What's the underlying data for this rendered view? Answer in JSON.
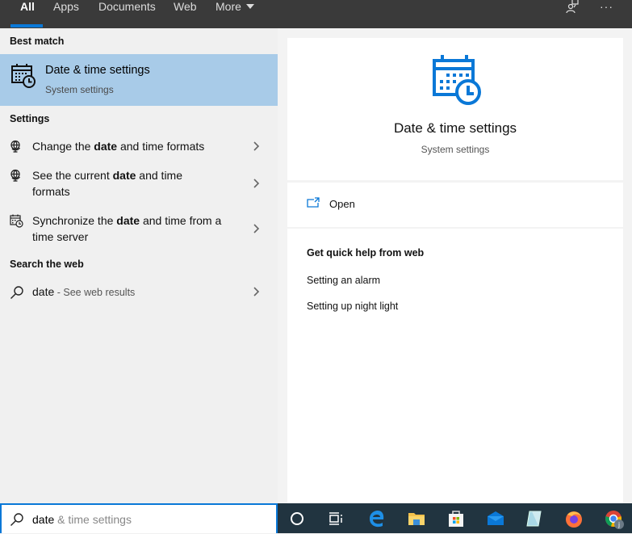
{
  "tabs": [
    {
      "label": "All",
      "active": true
    },
    {
      "label": "Apps",
      "active": false
    },
    {
      "label": "Documents",
      "active": false
    },
    {
      "label": "Web",
      "active": false
    },
    {
      "label": "More",
      "active": false
    }
  ],
  "top_icons": {
    "feedback": "feedback-icon",
    "more": "more-options-icon",
    "more_glyph": "···"
  },
  "left": {
    "best_match_header": "Best match",
    "best_match": {
      "title": "Date & time settings",
      "subtitle": "System settings",
      "icon": "date-time-icon"
    },
    "settings_header": "Settings",
    "settings_items": [
      {
        "pre": "Change the ",
        "bold": "date",
        "post": " and time formats",
        "icon": "globe-icon"
      },
      {
        "pre": "See the current ",
        "bold": "date",
        "post": " and time formats",
        "icon": "globe-icon"
      },
      {
        "pre": "Synchronize the ",
        "bold": "date",
        "post": " and time from a time server",
        "icon": "date-time-icon"
      }
    ],
    "web_header": "Search the web",
    "web_item": {
      "query": "date",
      "suffix": " - See web results",
      "icon": "search-icon"
    }
  },
  "preview": {
    "title": "Date & time settings",
    "subtitle": "System settings",
    "open_label": "Open",
    "quick_help_header": "Get quick help from web",
    "quick_links": [
      "Setting an alarm",
      "Setting up night light"
    ]
  },
  "search": {
    "typed": "date",
    "completion": " & time settings"
  },
  "taskbar": {
    "icons": [
      "cortana-icon",
      "task-view-icon",
      "edge-icon",
      "file-explorer-icon",
      "store-icon",
      "mail-icon",
      "notepad-icon",
      "firefox-icon",
      "chrome-icon"
    ]
  },
  "colors": {
    "accent": "#0a78d7",
    "selection": "#a8cbe8",
    "topbar": "#3a3a3a",
    "taskbar": "#213440"
  }
}
